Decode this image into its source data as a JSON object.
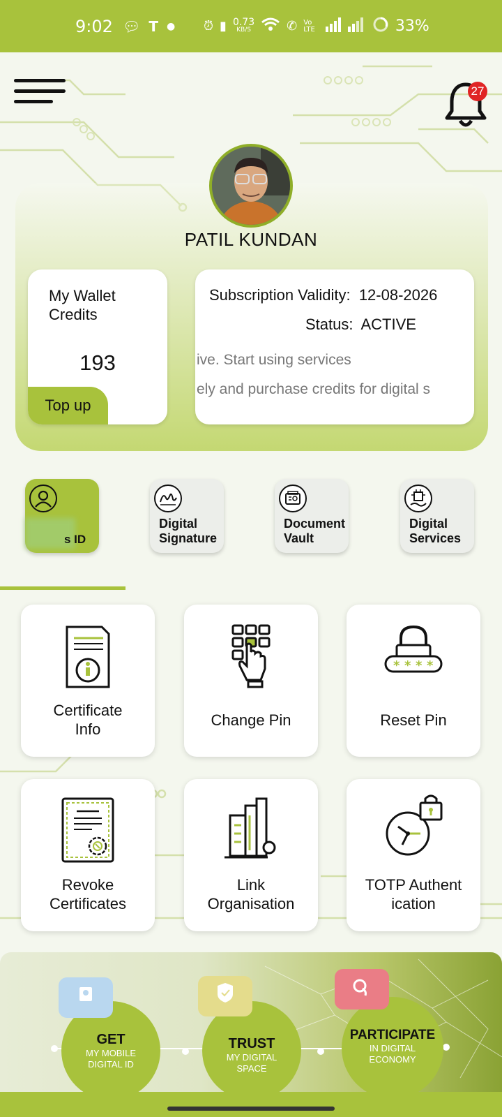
{
  "status_bar": {
    "time": "9:02",
    "net_speed_value": "0.73",
    "net_speed_unit": "KB/S",
    "battery": "33%",
    "left_icons": [
      "chat-icon",
      "teams-icon",
      "dot-icon"
    ],
    "right_icons": [
      "alarm-icon",
      "vibrate-icon",
      "wifi-icon",
      "wifi-call-icon",
      "volte-icon",
      "signal-icon",
      "battery-icon"
    ]
  },
  "header": {
    "notification_count": "27",
    "menu_icon": "hamburger-menu-icon",
    "bell_icon": "bell-icon"
  },
  "profile": {
    "name": "PATIL KUNDAN"
  },
  "wallet": {
    "title_line1": "My Wallet",
    "title_line2": "Credits",
    "value": "193",
    "topup_label": "Top up"
  },
  "subscription": {
    "validity_label": "Subscription Validity:",
    "validity_value": "12-08-2026",
    "status_label": "Status:",
    "status_value": "ACTIVE",
    "marquee_line1": "ive. Start using services",
    "marquee_line2": "ely and purchase credits for digital s"
  },
  "quick_tabs": [
    {
      "label_line1": "",
      "label_line2": "s ID",
      "icon": "user-circle-icon",
      "active": true
    },
    {
      "label_line1": "Digital",
      "label_line2": "Signature",
      "icon": "signature-icon",
      "active": false
    },
    {
      "label_line1": "Document",
      "label_line2": "Vault",
      "icon": "vault-icon",
      "active": false
    },
    {
      "label_line1": "Digital",
      "label_line2": "Services",
      "icon": "chip-icon",
      "active": false
    }
  ],
  "tiles": [
    {
      "line1": "Certificate",
      "line2": "Info",
      "icon": "certificate-info-icon"
    },
    {
      "line1": "Change Pin",
      "line2": "",
      "icon": "keypad-touch-icon"
    },
    {
      "line1": "Reset Pin",
      "line2": "",
      "icon": "padlock-password-icon"
    },
    {
      "line1": "Revoke",
      "line2": "Certificates",
      "icon": "revoke-certificate-icon"
    },
    {
      "line1": "Link",
      "line2": "Organisation",
      "icon": "building-link-icon"
    },
    {
      "line1": "TOTP Authent",
      "line2": "ication",
      "icon": "clock-lock-icon"
    }
  ],
  "promo": {
    "steps": [
      {
        "big": "GET",
        "small1": "MY MOBILE",
        "small2": "DIGITAL ID",
        "bubble_color": "#b9d7ef",
        "icon": "id-card-icon"
      },
      {
        "big": "TRUST",
        "small1": "MY  DIGITAL",
        "small2": "SPACE",
        "bubble_color": "#e4dc8c",
        "icon": "shield-check-icon"
      },
      {
        "big": "PARTICIPATE",
        "small1": "IN DIGITAL",
        "small2": "ECONOMY",
        "bubble_color": "#ea7d86",
        "icon": "handshake-icon"
      }
    ]
  },
  "colors": {
    "accent": "#a8c23c",
    "badge": "#e02424"
  }
}
